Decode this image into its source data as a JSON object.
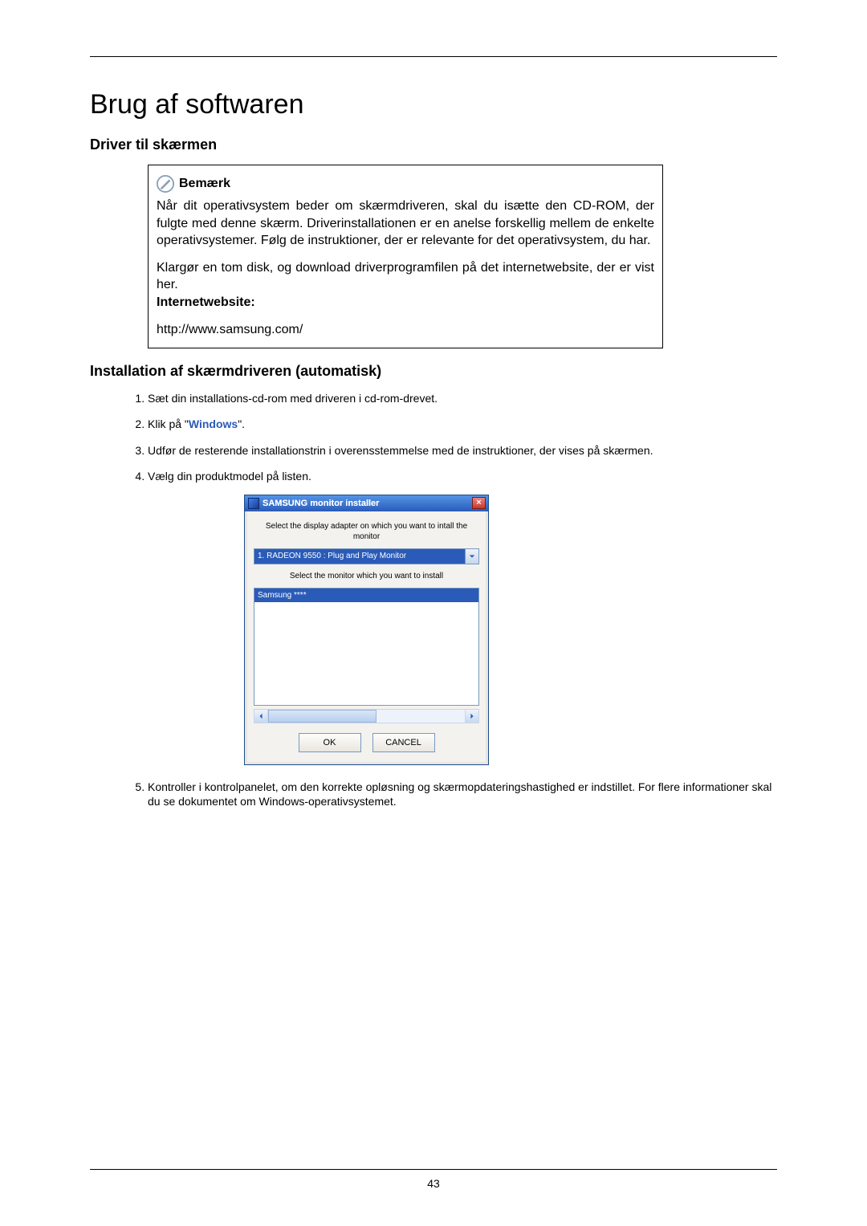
{
  "page_number": "43",
  "title": "Brug af softwaren",
  "section_driver_heading": "Driver til skærmen",
  "note_label": "Bemærk",
  "note_p1": "Når dit operativsystem beder om skærmdriveren, skal du isætte den CD-ROM, der fulgte med denne skærm. Driverinstallationen er en anelse forskellig mellem de enkelte operativsystemer. Følg de instruktioner, der er relevante for det operativsystem, du har.",
  "note_p2": "Klargør en tom disk, og download driverprogramfilen på det internetwebsite, der er vist her.",
  "note_inet_label": "Internetwebsite:",
  "note_url": "http://www.samsung.com/",
  "section_install_heading": "Installation af skærmdriveren (automatisk)",
  "steps": {
    "s1": "Sæt din installations-cd-rom med driveren i cd-rom-drevet.",
    "s2_a": "Klik på \"",
    "s2_b": "Windows",
    "s2_c": "\".",
    "s3": "Udfør de resterende installationstrin i overensstemmelse med de instruktioner, der vises på skærmen.",
    "s4": "Vælg din produktmodel på listen.",
    "s5": "Kontroller i kontrolpanelet, om den korrekte opløsning og skærmopdateringshastighed er indstillet. For flere informationer skal du se dokumentet om Windows-operativsystemet."
  },
  "dialog": {
    "title": "SAMSUNG monitor installer",
    "caption1": "Select the display adapter on which you want to intall the monitor",
    "combo_selected": "1. RADEON 9550 : Plug and Play Monitor",
    "caption2": "Select the monitor which you want to install",
    "list_selected": "Samsung ****",
    "ok": "OK",
    "cancel": "CANCEL",
    "close_glyph": "×"
  }
}
